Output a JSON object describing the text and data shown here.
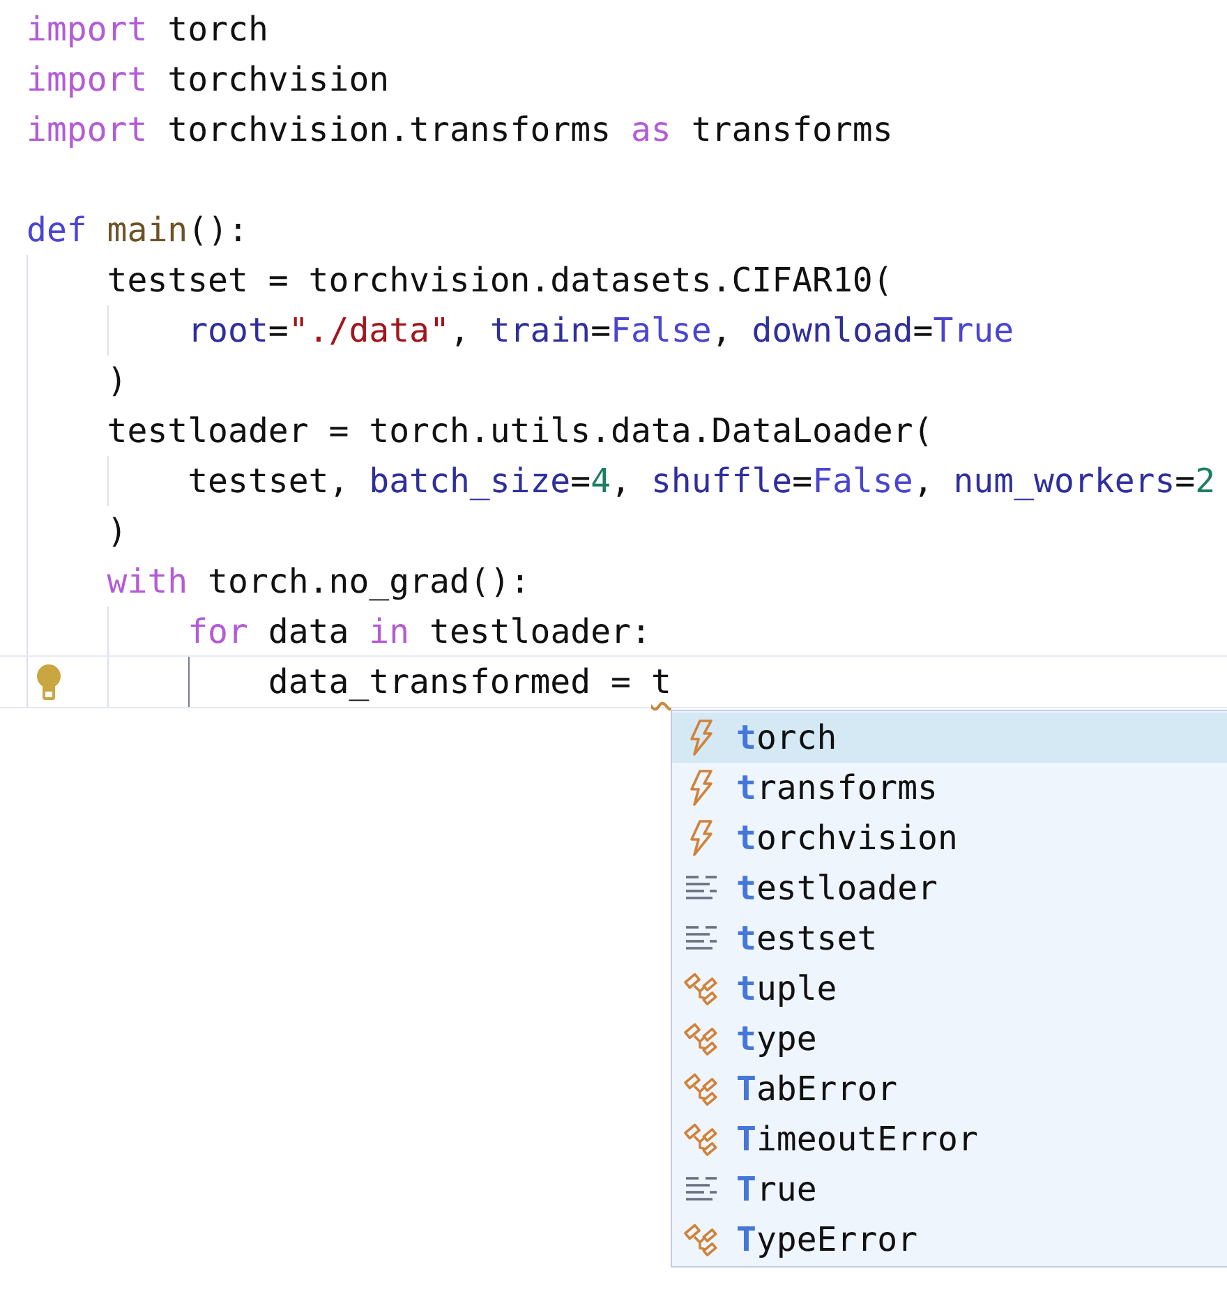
{
  "editor": {
    "lines": [
      {
        "kind": "code",
        "tokens": [
          {
            "kind": "keyword",
            "text": "import"
          },
          {
            "kind": "text",
            "text": " torch"
          }
        ]
      },
      {
        "kind": "code",
        "tokens": [
          {
            "kind": "keyword",
            "text": "import"
          },
          {
            "kind": "text",
            "text": " torchvision"
          }
        ]
      },
      {
        "kind": "code",
        "tokens": [
          {
            "kind": "keyword",
            "text": "import"
          },
          {
            "kind": "text",
            "text": " torchvision.transforms "
          },
          {
            "kind": "keyword",
            "text": "as"
          },
          {
            "kind": "text",
            "text": " transforms"
          }
        ]
      },
      {
        "kind": "blank"
      },
      {
        "kind": "code",
        "tokens": [
          {
            "kind": "def",
            "text": "def "
          },
          {
            "kind": "function",
            "text": "main"
          },
          {
            "kind": "text",
            "text": "():"
          }
        ],
        "children": [
          {
            "kind": "code",
            "tokens": [
              {
                "kind": "text",
                "text": "testset = torchvision.datasets.CIFAR10("
              }
            ],
            "children": [
              {
                "kind": "code",
                "tokens": [
                  {
                    "kind": "param",
                    "text": "root"
                  },
                  {
                    "kind": "text",
                    "text": "="
                  },
                  {
                    "kind": "string",
                    "text": "\"./data\""
                  },
                  {
                    "kind": "text",
                    "text": ", "
                  },
                  {
                    "kind": "param",
                    "text": "train"
                  },
                  {
                    "kind": "text",
                    "text": "="
                  },
                  {
                    "kind": "constant",
                    "text": "False"
                  },
                  {
                    "kind": "text",
                    "text": ", "
                  },
                  {
                    "kind": "param",
                    "text": "download"
                  },
                  {
                    "kind": "text",
                    "text": "="
                  },
                  {
                    "kind": "constant",
                    "text": "True"
                  }
                ]
              }
            ]
          },
          {
            "kind": "code",
            "tokens": [
              {
                "kind": "text",
                "text": ")"
              }
            ]
          },
          {
            "kind": "code",
            "tokens": [
              {
                "kind": "text",
                "text": "testloader = torch.utils.data.DataLoader("
              }
            ],
            "children": [
              {
                "kind": "code",
                "tokens": [
                  {
                    "kind": "text",
                    "text": "testset, "
                  },
                  {
                    "kind": "param",
                    "text": "batch_size"
                  },
                  {
                    "kind": "text",
                    "text": "="
                  },
                  {
                    "kind": "number",
                    "text": "4"
                  },
                  {
                    "kind": "text",
                    "text": ", "
                  },
                  {
                    "kind": "param",
                    "text": "shuffle"
                  },
                  {
                    "kind": "text",
                    "text": "="
                  },
                  {
                    "kind": "constant",
                    "text": "False"
                  },
                  {
                    "kind": "text",
                    "text": ", "
                  },
                  {
                    "kind": "param",
                    "text": "num_workers"
                  },
                  {
                    "kind": "text",
                    "text": "="
                  },
                  {
                    "kind": "number",
                    "text": "2"
                  }
                ]
              }
            ]
          },
          {
            "kind": "code",
            "tokens": [
              {
                "kind": "text",
                "text": ")"
              }
            ]
          },
          {
            "kind": "code",
            "tokens": [
              {
                "kind": "keyword",
                "text": "with"
              },
              {
                "kind": "text",
                "text": " torch.no_grad():"
              }
            ],
            "children": [
              {
                "kind": "code",
                "tokens": [
                  {
                    "kind": "keyword",
                    "text": "for"
                  },
                  {
                    "kind": "text",
                    "text": " data "
                  },
                  {
                    "kind": "keyword",
                    "text": "in"
                  },
                  {
                    "kind": "text",
                    "text": " testloader:"
                  }
                ],
                "children": [
                  {
                    "kind": "code",
                    "current": true,
                    "lightbulb": true,
                    "tokens": [
                      {
                        "kind": "text",
                        "text": "data_transformed = "
                      },
                      {
                        "kind": "text",
                        "text": "t",
                        "squiggle": true
                      }
                    ]
                  }
                ]
              }
            ]
          }
        ]
      }
    ]
  },
  "completion": {
    "items": [
      {
        "kind": "function",
        "label": "**t**orch",
        "selected": true
      },
      {
        "kind": "function",
        "label": "**t**ransforms",
        "selected": false
      },
      {
        "kind": "function",
        "label": "**t**orchvision",
        "selected": false
      },
      {
        "kind": "variable",
        "label": "**t**estloader",
        "selected": false
      },
      {
        "kind": "variable",
        "label": "**t**estset",
        "selected": false
      },
      {
        "kind": "class",
        "label": "**t**uple",
        "selected": false
      },
      {
        "kind": "class",
        "label": "**t**ype",
        "selected": false
      },
      {
        "kind": "class",
        "label": "**T**abError",
        "selected": false
      },
      {
        "kind": "class",
        "label": "**T**imeoutError",
        "selected": false
      },
      {
        "kind": "variable",
        "label": "**T**rue",
        "selected": false
      },
      {
        "kind": "class",
        "label": "**T**ypeError",
        "selected": false
      }
    ]
  }
}
